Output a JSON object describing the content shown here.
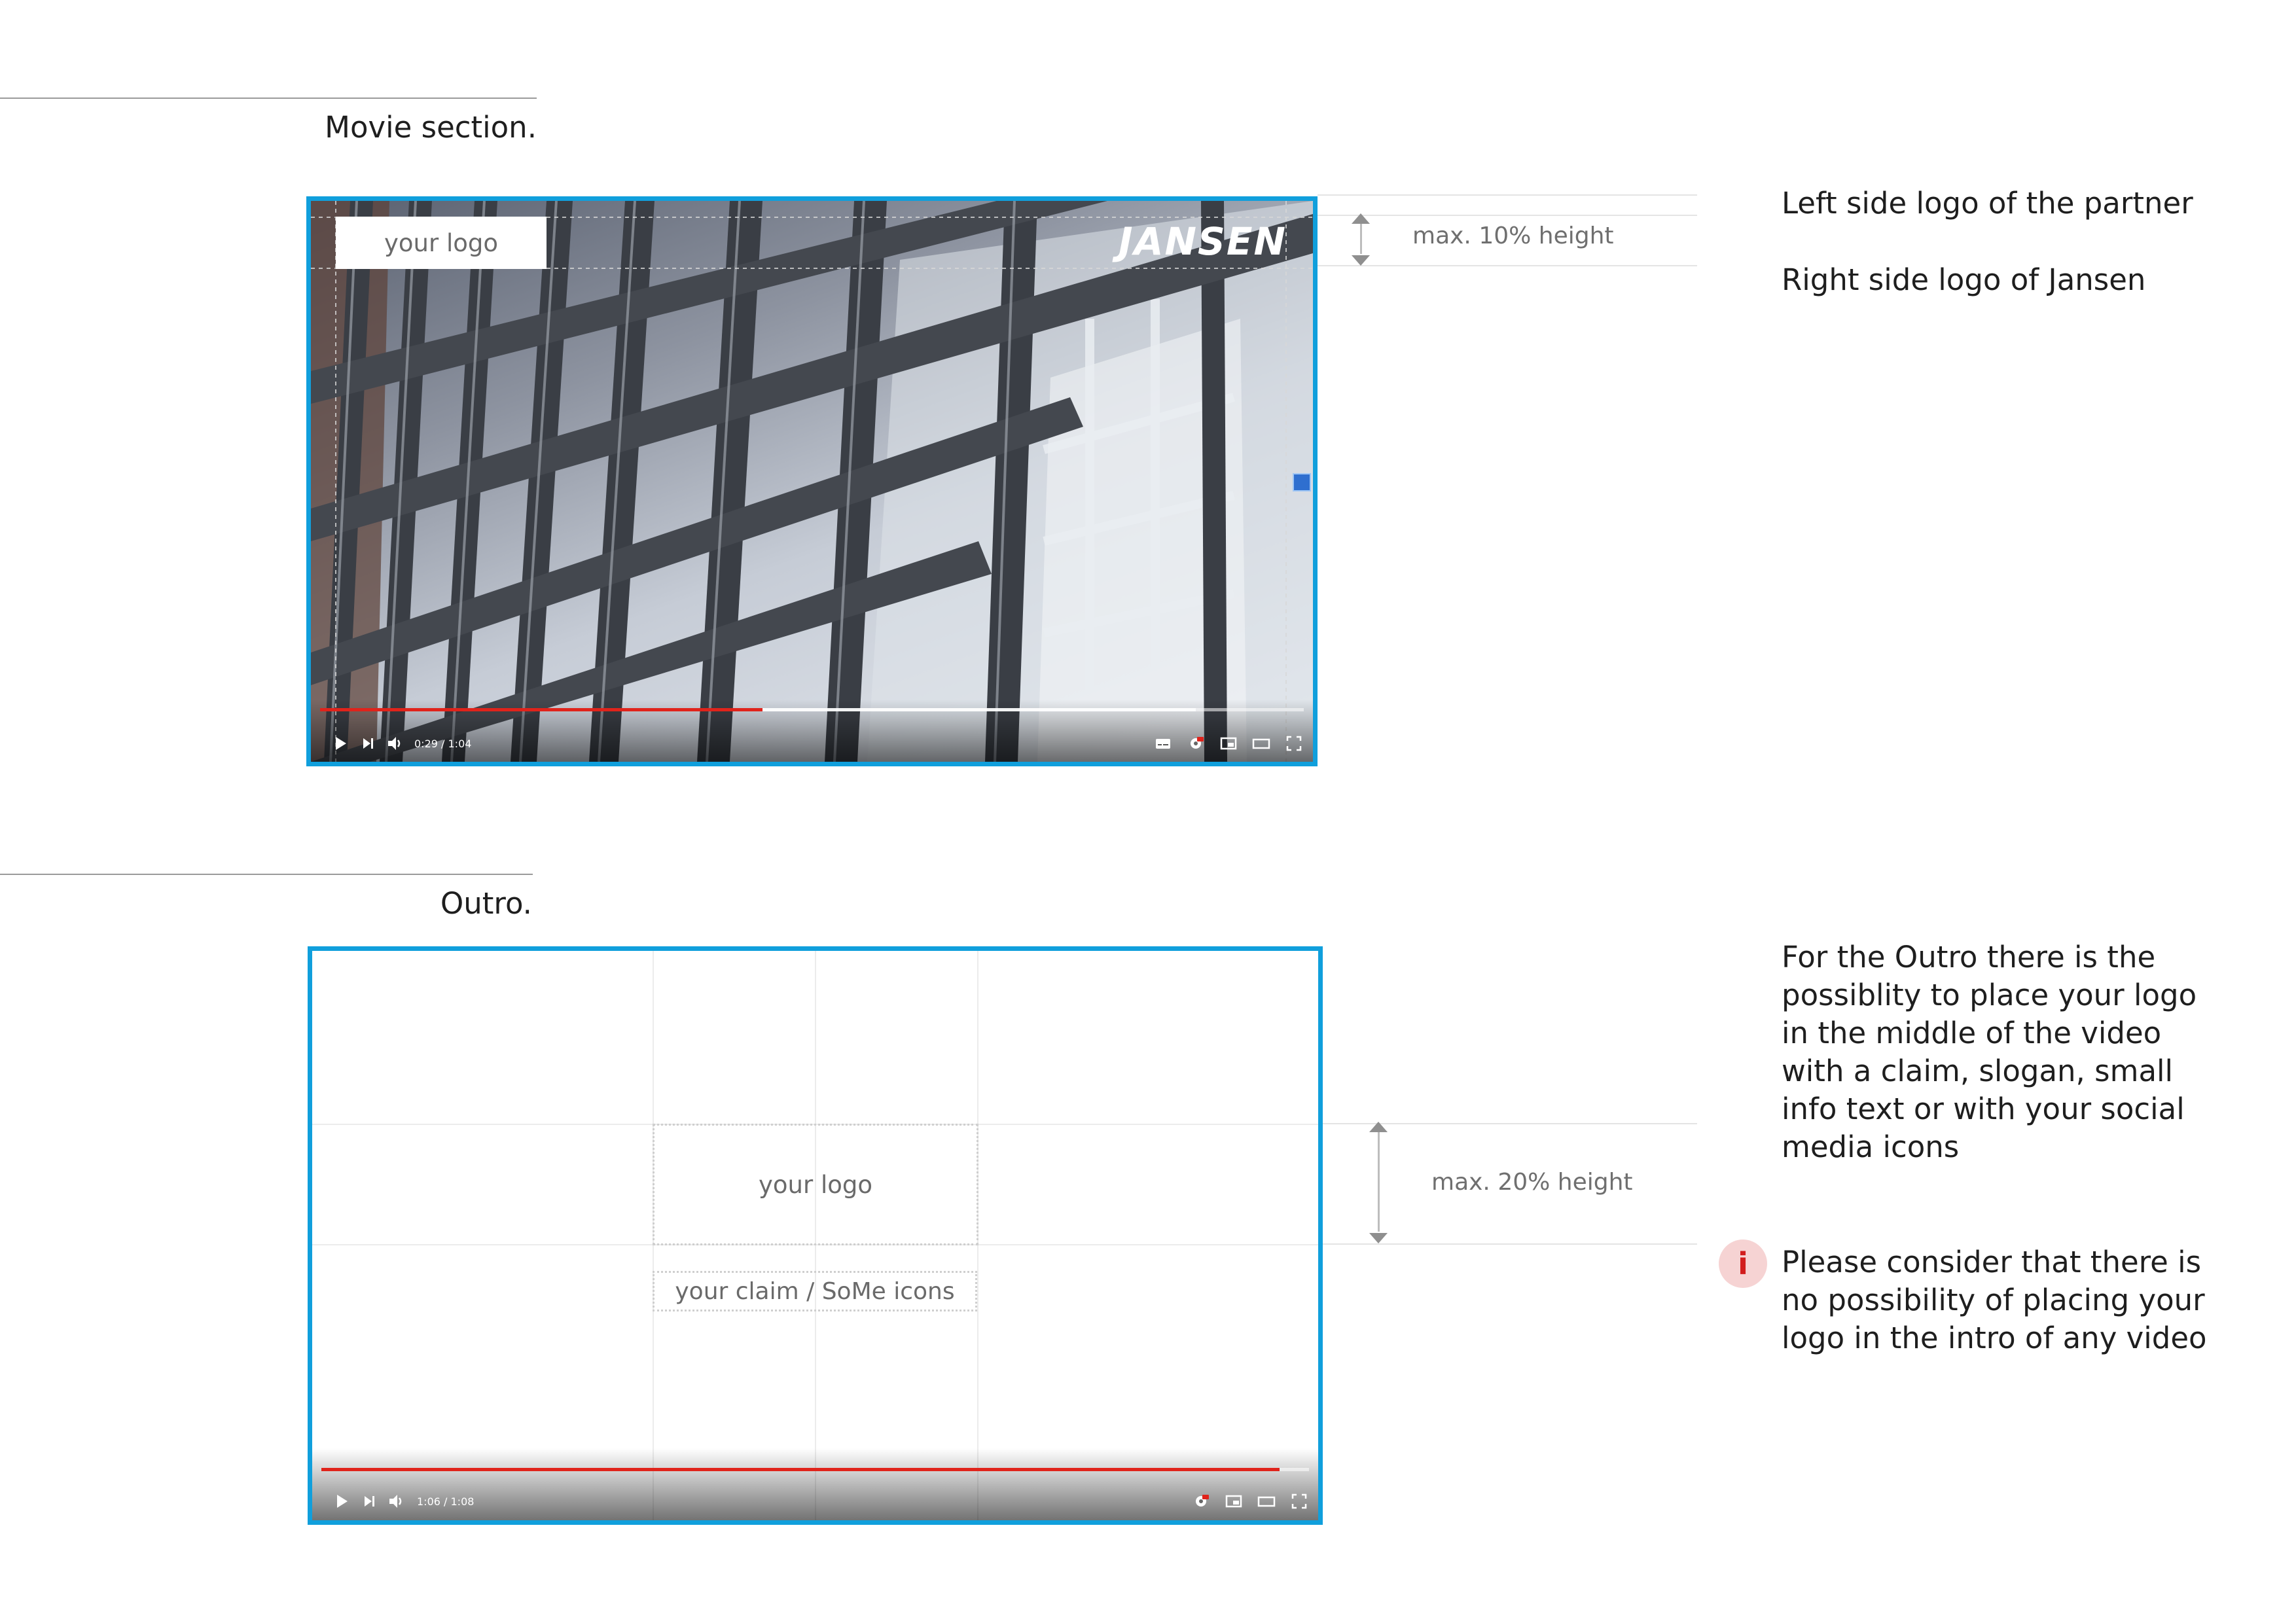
{
  "movie_section": {
    "heading": "Movie section.",
    "partner_logo_label": "your logo",
    "brand_logo_text": "JANSEN",
    "player": {
      "time_display": "0:29 / 1:04",
      "progress_fraction": 0.45,
      "buffered_fraction": 0.89
    },
    "dimension_label": "max. 10% height",
    "notes": [
      "Left side logo of the partner",
      "Right side logo of Jansen"
    ]
  },
  "outro_section": {
    "heading": "Outro.",
    "logo_label": "your logo",
    "claim_label": "your claim / SoMe icons",
    "player": {
      "time_display": "1:06 / 1:08",
      "progress_fraction": 0.97
    },
    "dimension_label": "max. 20% height",
    "description": "For the Outro there is the possiblity to place your logo in the middle of the video with a claim, slogan, small info text or with your social media icons",
    "info_icon": "i",
    "info_note": "Please consider that there is no possibility of placing your logo in the intro of any video"
  },
  "colors": {
    "frame_border": "#109fdc",
    "progress_red": "#e0231b",
    "info_red": "#d21d1d",
    "info_bg": "#f6d3d3"
  }
}
